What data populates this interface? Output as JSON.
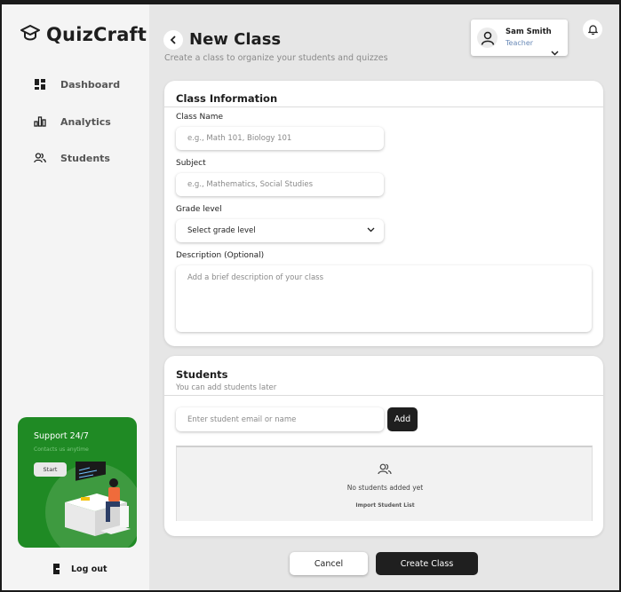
{
  "app": {
    "name": "QuizCraft"
  },
  "sidebar": {
    "items": [
      {
        "label": "Dashboard",
        "icon": "dashboard-icon"
      },
      {
        "label": "Analytics",
        "icon": "bar-chart-icon"
      },
      {
        "label": "Students",
        "icon": "users-icon"
      }
    ],
    "support": {
      "title": "Support 24/7",
      "subtitle": "Contacts us anytime",
      "button": "Start"
    },
    "logout": "Log out"
  },
  "header": {
    "title": "New Class",
    "subtitle": "Create a class to organize your students and quizzes",
    "user": {
      "name": "Sam Smith",
      "role": "Teacher"
    }
  },
  "class_info": {
    "title": "Class Information",
    "class_name": {
      "label": "Class Name",
      "placeholder": "e.g., Math 101, Biology 101",
      "value": ""
    },
    "subject": {
      "label": "Subject",
      "placeholder": "e.g., Mathematics, Social Studies",
      "value": ""
    },
    "grade": {
      "label": "Grade level",
      "selected": "Select grade level"
    },
    "description": {
      "label": "Description (Optional)",
      "placeholder": "Add a brief description of your class",
      "value": ""
    }
  },
  "students": {
    "title": "Students",
    "subtitle": "You can add students later",
    "input_placeholder": "Enter student email or name",
    "add_label": "Add",
    "empty_text": "No students added yet",
    "import_label": "Import Student List"
  },
  "actions": {
    "cancel": "Cancel",
    "create": "Create Class"
  },
  "colors": {
    "accent_green": "#1f8a24",
    "dark_button": "#1f1f1f",
    "role_blue": "#6a8ab7",
    "background": "#e6e6e6"
  }
}
